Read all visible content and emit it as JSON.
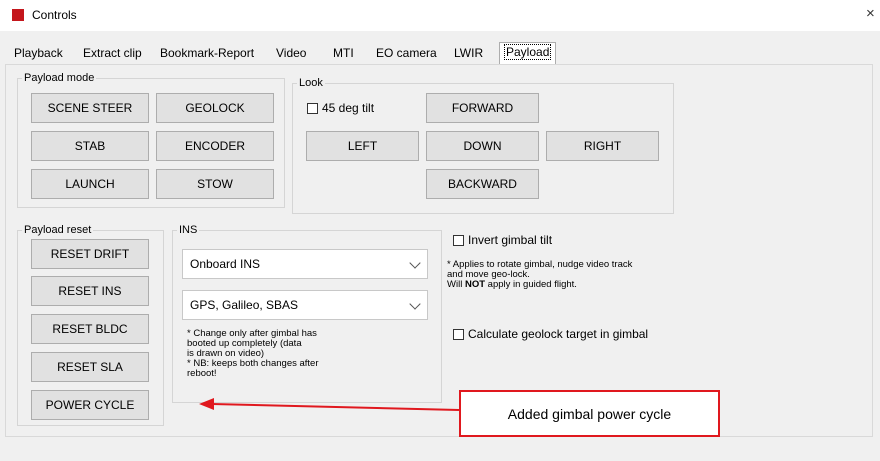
{
  "window": {
    "title": "Controls",
    "close_glyph": "×"
  },
  "tabs": [
    {
      "label": "Playback"
    },
    {
      "label": "Extract clip"
    },
    {
      "label": "Bookmark-Report"
    },
    {
      "label": "Video"
    },
    {
      "label": "MTI"
    },
    {
      "label": "EO camera"
    },
    {
      "label": "LWIR"
    },
    {
      "label": "Payload"
    }
  ],
  "active_tab": "Payload",
  "payload_mode": {
    "label": "Payload mode",
    "buttons": [
      "SCENE STEER",
      "GEOLOCK",
      "STAB",
      "ENCODER",
      "LAUNCH",
      "STOW"
    ]
  },
  "look": {
    "label": "Look",
    "tilt_checkbox": "45 deg tilt",
    "forward": "FORWARD",
    "left": "LEFT",
    "down": "DOWN",
    "right": "RIGHT",
    "backward": "BACKWARD"
  },
  "payload_reset": {
    "label": "Payload reset",
    "buttons": [
      "RESET DRIFT",
      "RESET INS",
      "RESET BLDC",
      "RESET SLA",
      "POWER CYCLE"
    ]
  },
  "ins": {
    "label": "INS",
    "source_value": "Onboard INS",
    "gnss_value": "GPS, Galileo, SBAS",
    "note_lines": [
      "* Change only after gimbal has",
      "booted up completely (data",
      "is drawn on video)",
      "* NB: keeps both changes after",
      "reboot!"
    ]
  },
  "options": {
    "invert_tilt": "Invert gimbal tilt",
    "note1": "* Applies to rotate gimbal, nudge video track",
    "note2": "and move geo-lock.",
    "note3_pre": "Will ",
    "note3_bold": "NOT",
    "note3_post": " apply in guided flight.",
    "geolock_gimbal": "Calculate geolock target in gimbal"
  },
  "annotation": {
    "text": "Added gimbal power cycle",
    "color": "#e0181e"
  }
}
